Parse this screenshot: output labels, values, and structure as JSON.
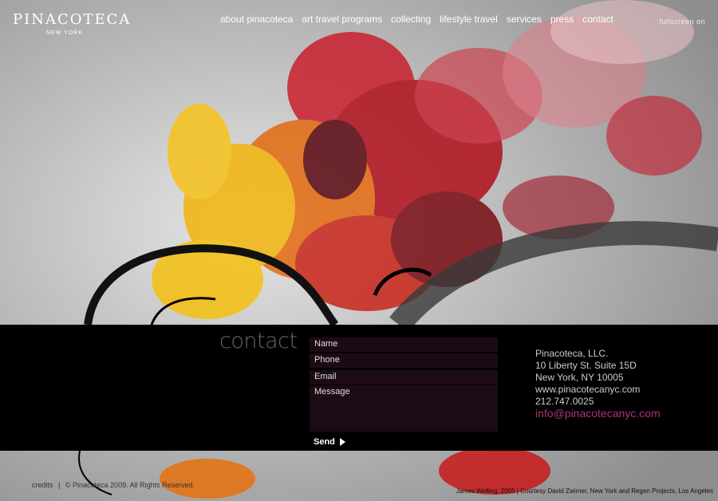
{
  "header": {
    "logo_main": "PINACOTECA",
    "logo_sub": "NEW YORK",
    "fullscreen_label": "fullscreen on"
  },
  "nav": {
    "items": [
      {
        "label": "about pinacoteca"
      },
      {
        "label": "art travel programs"
      },
      {
        "label": "collecting"
      },
      {
        "label": "lifestyle travel"
      },
      {
        "label": "services"
      },
      {
        "label": "press"
      },
      {
        "label": "contact"
      }
    ]
  },
  "contact": {
    "title": "contact",
    "fields": {
      "name": "Name",
      "phone": "Phone",
      "email": "Email",
      "message": "Message"
    },
    "send_label": "Send"
  },
  "address": {
    "company": "Pinacoteca, LLC.",
    "street": "10 Liberty St. Suite 15D",
    "city": "New York, NY 10005",
    "website": "www.pinacotecanyc.com",
    "phone": "212.747.0025",
    "email": "info@pinacotecanyc.com"
  },
  "footer": {
    "credits": "credits",
    "separator": "|",
    "copyright": "© Pinacoteca 2009. All Rights Reserved.",
    "caption": "James Welling, 2005 | Courtesy David Zwirner, New York and Regen Projects, Los Angeles"
  },
  "colors": {
    "band": "#000000",
    "field_bg": "#1c0b15",
    "email_accent": "#b0307a"
  }
}
